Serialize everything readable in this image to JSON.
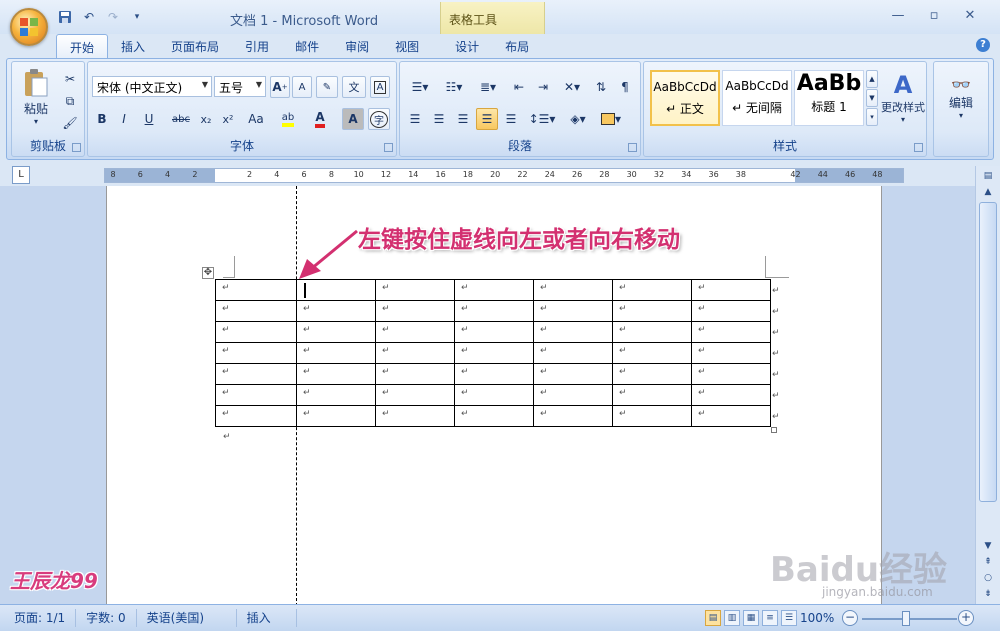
{
  "window": {
    "title": "文档 1 - Microsoft Word",
    "context_tools": "表格工具",
    "controls": [
      "—",
      "▫",
      "✕"
    ]
  },
  "quick_access": [
    "save-icon",
    "undo-icon",
    "redo-icon",
    "customize-icon"
  ],
  "tabs": [
    {
      "label": "开始",
      "active": true
    },
    {
      "label": "插入"
    },
    {
      "label": "页面布局"
    },
    {
      "label": "引用"
    },
    {
      "label": "邮件"
    },
    {
      "label": "审阅"
    },
    {
      "label": "视图"
    },
    {
      "label": "设计"
    },
    {
      "label": "布局"
    }
  ],
  "ribbon": {
    "clipboard": {
      "label": "剪贴板",
      "paste": "粘贴"
    },
    "font": {
      "label": "字体",
      "font_name": "宋体 (中文正文)",
      "font_size": "五号",
      "buttons": [
        "B",
        "I",
        "U",
        "abc",
        "x₂",
        "x²",
        "Aa",
        "A"
      ]
    },
    "paragraph": {
      "label": "段落"
    },
    "styles": {
      "label": "样式",
      "items": [
        {
          "sample": "AaBbCcDd",
          "name": "↵ 正文"
        },
        {
          "sample": "AaBbCcDd",
          "name": "↵ 无间隔"
        },
        {
          "sample": "AaBb",
          "name": "标题 1"
        }
      ],
      "change_styles": "更改样式"
    },
    "editing": {
      "label": "编辑"
    }
  },
  "ruler": {
    "ticks": [
      "8",
      "6",
      "4",
      "2",
      "",
      "2",
      "4",
      "6",
      "8",
      "10",
      "12",
      "14",
      "16",
      "18",
      "20",
      "22",
      "24",
      "26",
      "28",
      "30",
      "32",
      "34",
      "36",
      "38",
      "",
      "42",
      "44",
      "46",
      "48"
    ]
  },
  "document": {
    "annotation": "左键按住虚线向左或者向右移动",
    "table": {
      "rows": 7,
      "cols": 7,
      "cell_mark": "↵"
    },
    "paragraph_mark": "↵"
  },
  "statusbar": {
    "page": "页面: 1/1",
    "words": "字数: 0",
    "language": "英语(美国)",
    "mode": "插入",
    "zoom": "100%"
  },
  "watermarks": {
    "author": "王辰龙99",
    "site": "Baidu经验",
    "site_url": "jingyan.baidu.com"
  }
}
